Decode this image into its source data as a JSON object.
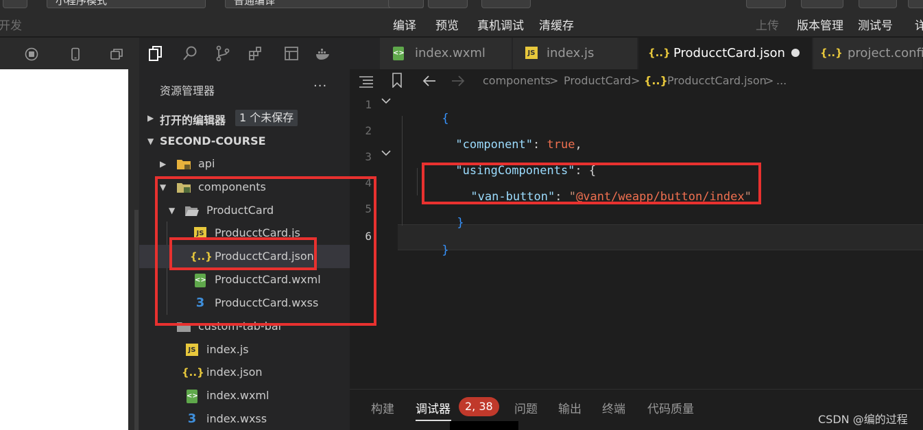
{
  "toolbar": {
    "mode_value": "小程序模式",
    "compile_value": "普通编译",
    "left_label": "开发",
    "actions": [
      "编译",
      "预览",
      "真机调试",
      "清缓存"
    ],
    "upload_label": "上传",
    "version_label": "版本管理",
    "test_label": "测试号",
    "detail_label": "详"
  },
  "explorer": {
    "title": "资源管理器",
    "more": "···",
    "open_editors": "打开的编辑器",
    "unsaved_badge": "1 个未保存",
    "project": "SECOND-COURSE",
    "tree": [
      {
        "name": "api"
      },
      {
        "name": "components"
      },
      {
        "name": "ProductCard"
      },
      {
        "name": "ProducctCard.js",
        "icon": "JS"
      },
      {
        "name": "ProducctCard.json",
        "icon": "{..}"
      },
      {
        "name": "ProducctCard.wxml",
        "icon": "<>"
      },
      {
        "name": "ProducctCard.wxss",
        "icon": "3"
      },
      {
        "name": "custom-tab-bar"
      },
      {
        "name": "index.js",
        "icon": "JS"
      },
      {
        "name": "index.json",
        "icon": "{..}"
      },
      {
        "name": "index.wxml",
        "icon": "<>"
      },
      {
        "name": "index.wxss",
        "icon": "3"
      }
    ]
  },
  "tabs": [
    {
      "label": "index.wxml",
      "icon": "<>"
    },
    {
      "label": "index.js",
      "icon": "JS"
    },
    {
      "label": "ProducctCard.json",
      "icon": "{..}"
    },
    {
      "label": "project.config",
      "icon": "{..}"
    }
  ],
  "breadcrumb": {
    "parts": [
      "components",
      "ProductCard",
      "ProducctCard.json",
      "..."
    ],
    "sep": ">",
    "json_icon": "{..}"
  },
  "code": {
    "line_numbers": [
      "1",
      "2",
      "3",
      "4",
      "5",
      "6"
    ],
    "l1": "{",
    "l2_key": "\"component\"",
    "l2_colon": ": ",
    "l2_val": "true",
    "l2_comma": ",",
    "l3_key": "\"usingComponents\"",
    "l3_rest": ": {",
    "l4_key": "\"van-button\"",
    "l4_colon": ": ",
    "l4_q1": "\"",
    "l4_val": "@vant/weapp/button/index",
    "l4_q2": "\"",
    "l5": "}",
    "l6": "}"
  },
  "panel": {
    "tabs": [
      "构建",
      "调试器",
      "问题",
      "输出",
      "终端",
      "代码质量"
    ],
    "error_badge": "2, 38"
  },
  "watermark": "CSDN @编的过程",
  "colors": {
    "annotation_red": "#e8312f",
    "json_key": "#9cdcfe",
    "json_string": "#ce9178",
    "js_icon": "#e8c83c",
    "wxml_icon": "#5fa84b",
    "wxss_icon": "#3f8fdc"
  }
}
